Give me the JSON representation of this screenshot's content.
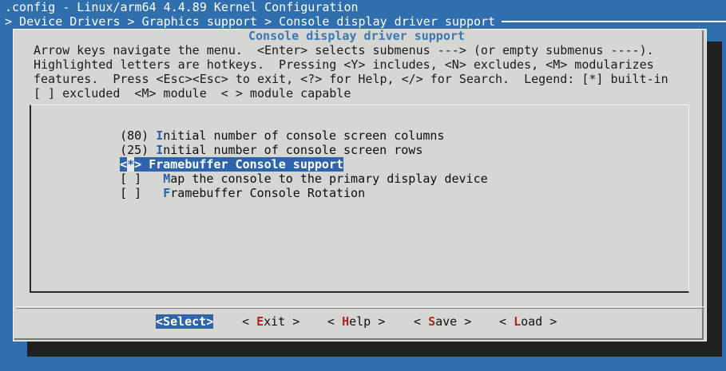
{
  "header": {
    "title": ".config - Linux/arm64 4.4.89 Kernel Configuration",
    "breadcrumb": "> Device Drivers > Graphics support > Console display driver support"
  },
  "dialog": {
    "title": "Console display driver support",
    "help_lines": [
      "Arrow keys navigate the menu.  <Enter> selects submenus ---> (or empty submenus ----).",
      "Highlighted letters are hotkeys.  Pressing <Y> includes, <N> excludes, <M> modularizes",
      "features.  Press <Esc><Esc> to exit, <?> for Help, </> for Search.  Legend: [*] built-in",
      "[ ] excluded  <M> module  < > module capable"
    ]
  },
  "menu": {
    "items": [
      {
        "prefix": "(80) ",
        "hotkey": "I",
        "rest": "nitial number of console screen columns"
      },
      {
        "prefix": "(25) ",
        "hotkey": "I",
        "rest": "nitial number of console screen rows"
      },
      {
        "prefix_open": "<",
        "cursor": "*",
        "prefix_close": "> ",
        "hotkey": "F",
        "rest": "ramebuffer Console support"
      },
      {
        "prefix": "[ ]   ",
        "hotkey": "M",
        "rest": "ap the console to the primary display device"
      },
      {
        "prefix": "[ ]   ",
        "hotkey": "F",
        "rest": "ramebuffer Console Rotation"
      }
    ]
  },
  "buttons": {
    "select": {
      "open": "<",
      "hot": "S",
      "rest": "elect",
      "close": ">"
    },
    "exit": {
      "open": "< ",
      "hot": "E",
      "rest": "xit",
      "close": " >"
    },
    "help": {
      "open": "< ",
      "hot": "H",
      "rest": "elp",
      "close": " >"
    },
    "save": {
      "open": "< ",
      "hot": "S",
      "rest": "ave",
      "close": " >"
    },
    "load": {
      "open": "< ",
      "hot": "L",
      "rest": "oad",
      "close": " >"
    }
  }
}
